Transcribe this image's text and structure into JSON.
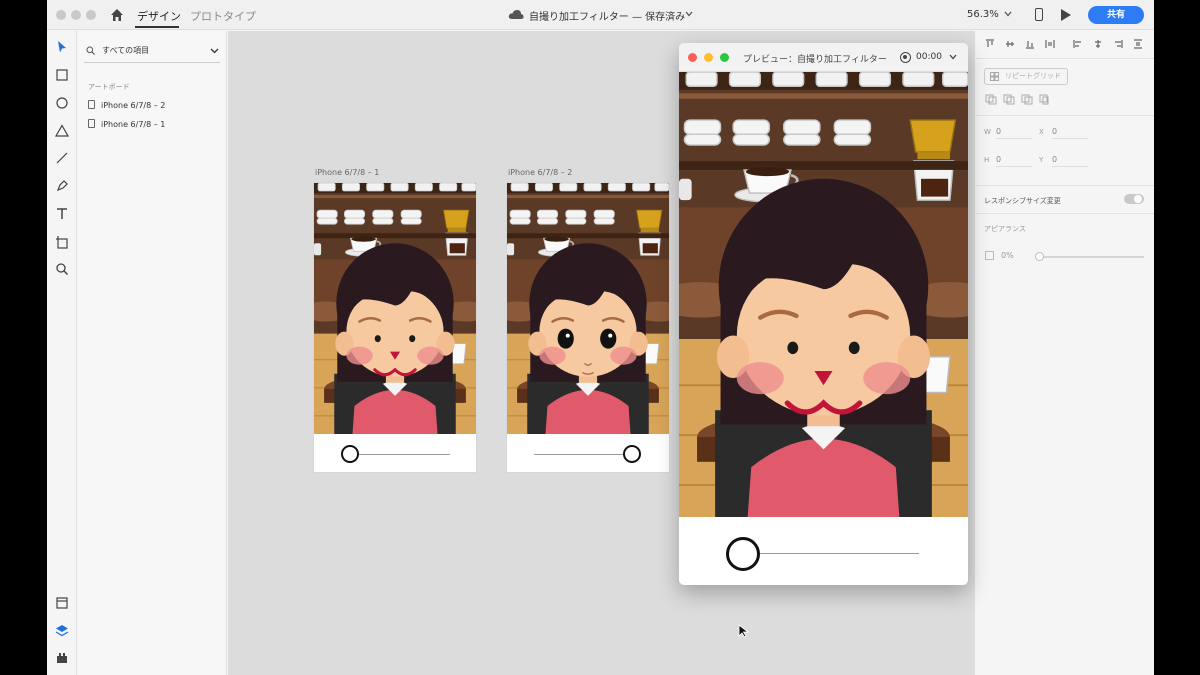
{
  "header": {
    "tabs": [
      {
        "label": "デザイン",
        "active": true
      },
      {
        "label": "プロトタイプ",
        "active": false
      }
    ],
    "document_title": "自撮り加工フィルター — 保存済み",
    "zoom": "56.3%",
    "share_label": "共有"
  },
  "layers": {
    "search_placeholder": "すべての項目",
    "section_label": "アートボード",
    "items": [
      {
        "label": "iPhone 6/7/8 – 2"
      },
      {
        "label": "iPhone 6/7/8 – 1"
      }
    ]
  },
  "canvas": {
    "artboards": [
      {
        "label": "iPhone 6/7/8 – 1",
        "face_variant": "smile",
        "slider_value": 0.0
      },
      {
        "label": "iPhone 6/7/8 – 2",
        "face_variant": "big-eyes",
        "slider_value": 1.0
      }
    ]
  },
  "preview": {
    "title": "プレビュー：自撮り加工フィルター",
    "record_time": "00:00",
    "face_variant": "smile",
    "slider_value": 0.0
  },
  "properties": {
    "repeat_grid_label": "リピートグリッド",
    "w_label": "W",
    "w_value": "0",
    "h_label": "H",
    "h_value": "0",
    "x_label": "X",
    "x_value": "0",
    "y_label": "Y",
    "y_value": "0",
    "responsive_label": "レスポンシブサイズ変更",
    "appearance_label": "アピアランス",
    "opacity_value": "0%"
  },
  "colors": {
    "accent": "#2d7cf6",
    "canvas": "#dcdcdc",
    "shirt": "#e05a6c",
    "hair": "#2a1a20",
    "skin": "#f6c9a0",
    "wood": "#7a4628"
  }
}
